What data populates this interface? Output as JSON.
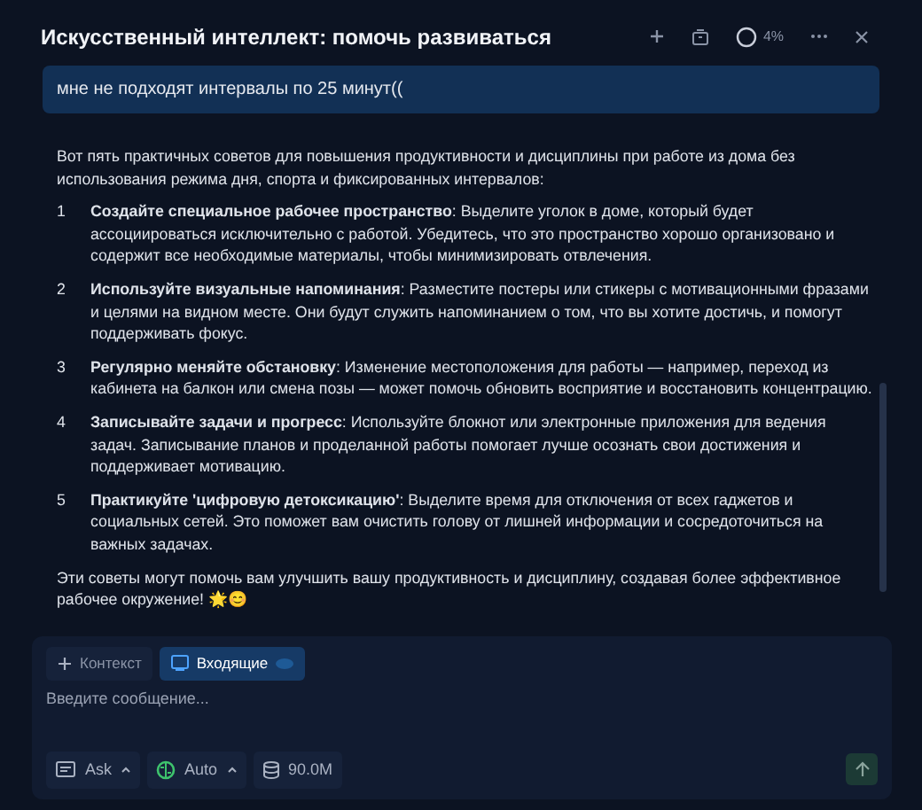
{
  "window": {
    "title": "Искусственный интеллект: помочь развиваться",
    "progress": {
      "reading": "4%"
    }
  },
  "user_message": "мне не подходят интервалы по 25 минут((",
  "answer": {
    "intro": "Вот пять практичных советов для повышения продуктивности и дисциплины при работе из дома без использования режима дня, спорта и фиксированных интервалов:",
    "items": [
      {
        "number": "1",
        "text": "**Создайте специальное рабочее пространство**: Выделите уголок в доме, который будет ассоциироваться исключительно с работой. Убедитесь, что это пространство хорошо организовано и содержит все необходимые материалы, чтобы минимизировать отвлечения."
      },
      {
        "number": "2",
        "text": "**Используйте визуальные напоминания**: Разместите постеры или стикеры с мотивационными фразами и целями на видном месте. Они будут служить напоминанием о том, что вы хотите достичь, и помогут поддерживать фокус."
      },
      {
        "number": "3",
        "text": "**Регулярно меняйте обстановку**: Изменение местоположения для работы — например, переход из кабинета на балкон или смена позы — может помочь обновить восприятие и восстановить концентрацию."
      },
      {
        "number": "4",
        "text": "**Записывайте задачи и прогресс**: Используйте блокнот или электронные приложения для ведения задач. Записывание планов и проделанной работы помогает лучше осознать свои достижения и поддерживает мотивацию."
      },
      {
        "number": "5",
        "text": "**Практикуйте 'цифровую детоксикацию'**: Выделите время для отключения от всех гаджетов и социальных сетей. Это поможет вам очистить голову от лишней информации и сосредоточиться на важных задачах."
      }
    ],
    "outro": "Эти советы могут помочь вам улучшить вашу продуктивность и дисциплину, создавая более эффективное рабочее окружение! 🌟😊"
  },
  "composer": {
    "chips": [
      {
        "kind": "add",
        "label": "Контекст",
        "selected": false
      },
      {
        "kind": "file",
        "label": "Входящие",
        "selected": true
      }
    ],
    "placeholder": "Введите сообщение...",
    "buttons": [
      {
        "kind": "mode",
        "label": "Ask"
      },
      {
        "kind": "model",
        "label": "Auto"
      },
      {
        "kind": "storage",
        "label": "90.0M"
      }
    ]
  }
}
